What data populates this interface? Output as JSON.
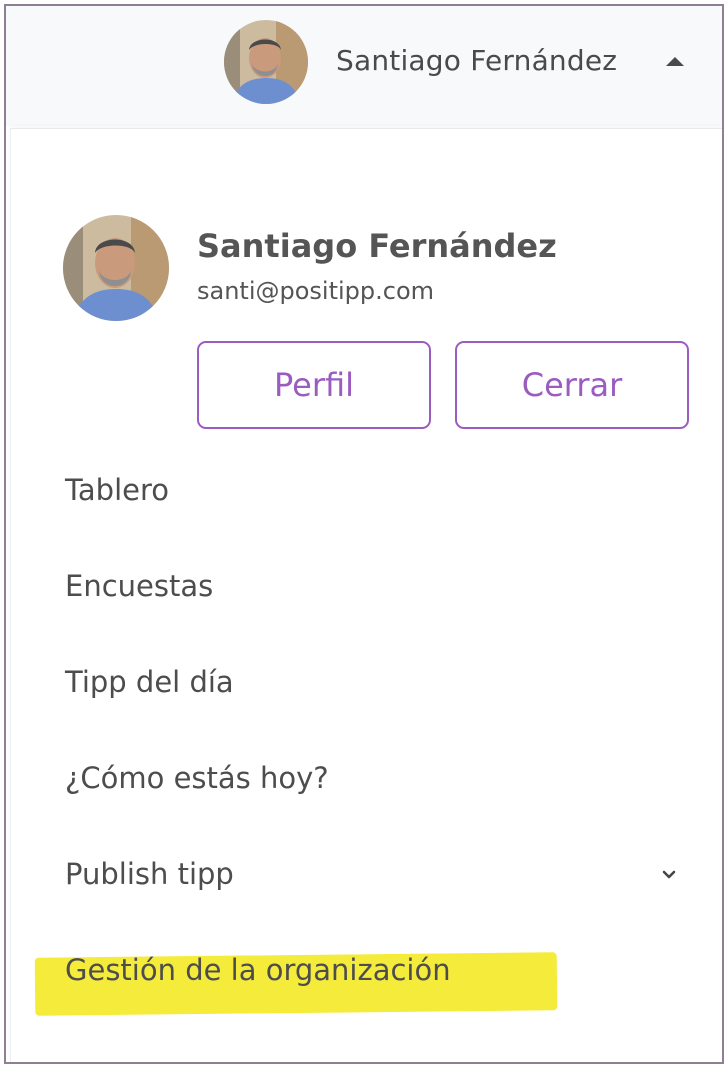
{
  "header": {
    "user_name": "Santiago Fernández",
    "avatar_icon": "avatar-photo",
    "toggle_icon": "caret-up-icon"
  },
  "profile": {
    "name": "Santiago Fernández",
    "email": "santi@positipp.com",
    "avatar_icon": "avatar-photo"
  },
  "actions": {
    "profile_label": "Perfil",
    "close_label": "Cerrar"
  },
  "menu": {
    "items": [
      {
        "label": "Tablero"
      },
      {
        "label": "Encuestas"
      },
      {
        "label": "Tipp del día"
      },
      {
        "label": "¿Cómo estás hoy?"
      },
      {
        "label": "Publish tipp",
        "icon": "chevron-down-icon"
      },
      {
        "label": "Gestión de la organización",
        "highlighted": true
      }
    ]
  },
  "colors": {
    "accent": "#9b5cc0",
    "highlight": "#f5eb3a",
    "text": "#4d4d4d",
    "border": "#8f7f93"
  }
}
